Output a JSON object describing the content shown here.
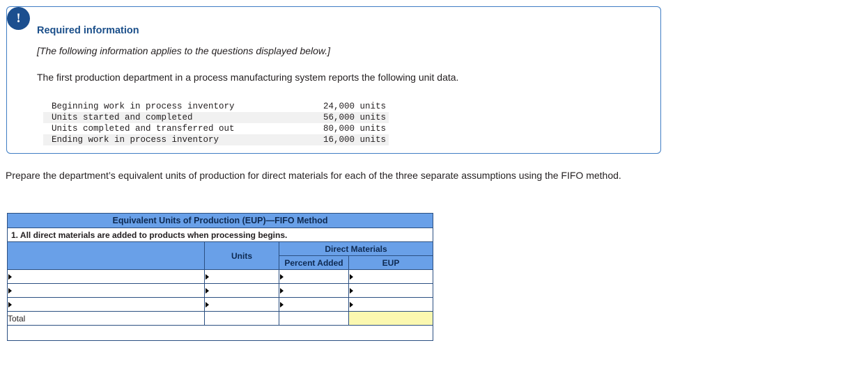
{
  "alert": {
    "icon": "exclamation-icon",
    "glyph": "!"
  },
  "required_info": {
    "title": "Required information",
    "note": "[The following information applies to the questions displayed below.]",
    "body": "The first production department in a process manufacturing system reports the following unit data.",
    "unit_data": [
      {
        "label": "Beginning work in process inventory",
        "value": "24,000 units"
      },
      {
        "label": "Units started and completed",
        "value": "56,000 units"
      },
      {
        "label": "Units completed and transferred out",
        "value": "80,000 units"
      },
      {
        "label": "Ending work in process inventory",
        "value": "16,000 units"
      }
    ]
  },
  "instruction": "Prepare the department’s equivalent units of production for direct materials for each of the three separate assumptions using the FIFO method.",
  "worksheet": {
    "title": "Equivalent Units of Production (EUP)—FIFO Method",
    "assumption": "1. All direct materials are added to products when processing begins.",
    "columns": {
      "description": "",
      "units": "Units",
      "group": "Direct Materials",
      "percent_added": "Percent Added",
      "eup": "EUP"
    },
    "rows": [
      {
        "description": "",
        "units": "",
        "percent_added": "",
        "eup": ""
      },
      {
        "description": "",
        "units": "",
        "percent_added": "",
        "eup": ""
      },
      {
        "description": "",
        "units": "",
        "percent_added": "",
        "eup": ""
      }
    ],
    "total_label": "Total",
    "total_units": "",
    "total_percent": "",
    "total_eup": ""
  },
  "colors": {
    "header_blue": "#69a0e8",
    "border_blue": "#2b4f81",
    "badge_blue": "#1c4f8f",
    "title_blue": "#1b4f8a",
    "highlight_yellow": "#fbf8b0"
  }
}
